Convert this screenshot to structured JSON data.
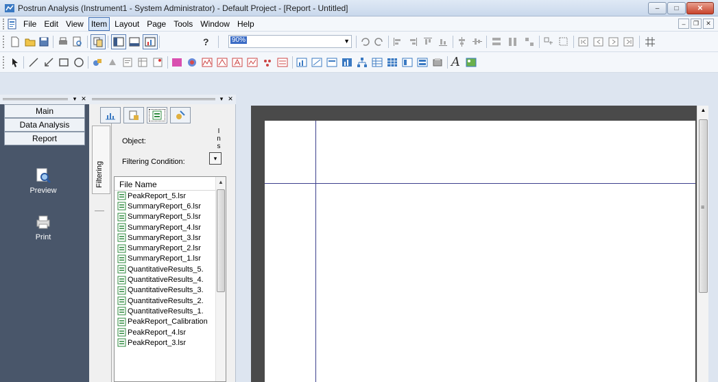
{
  "window": {
    "title": "Postrun Analysis (Instrument1 - System Administrator) - Default Project - [Report - Untitled]",
    "minimize_icon": "minimize-icon",
    "maximize_icon": "maximize-icon",
    "close_icon": "close-icon"
  },
  "menubar": {
    "items": [
      "File",
      "Edit",
      "View",
      "Item",
      "Layout",
      "Page",
      "Tools",
      "Window",
      "Help"
    ],
    "active_item": "Item"
  },
  "toolbar": {
    "zoom_value": "90%",
    "help_label": "?",
    "font_label": "A"
  },
  "leftnav": {
    "tabs": [
      "Main",
      "Data Analysis",
      "Report"
    ],
    "tiles": [
      {
        "label": "Preview",
        "icon": "preview-icon"
      },
      {
        "label": "Print",
        "icon": "printer-icon"
      }
    ],
    "background": "#49566a"
  },
  "midpanel": {
    "vertical_tab": "Filtering",
    "object_label": "Object:",
    "filter_label": "Filtering Condition:",
    "truncated_column": "Ins",
    "filelist_header": "File Name",
    "files": [
      "PeakReport_5.lsr",
      "SummaryReport_6.lsr",
      "SummaryReport_5.lsr",
      "SummaryReport_4.lsr",
      "SummaryReport_3.lsr",
      "SummaryReport_2.lsr",
      "SummaryReport_1.lsr",
      "QuantitativeResults_5.",
      "QuantitativeResults_4.",
      "QuantitativeResults_3.",
      "QuantitativeResults_2.",
      "QuantitativeResults_1.",
      "PeakReport_Calibration",
      "PeakReport_4.lsr",
      "PeakReport_3.lsr"
    ]
  },
  "colors": {
    "accent": "#3b6cc5",
    "report_line": "#3b3e8c",
    "report_bg": "#4a4a4a"
  }
}
